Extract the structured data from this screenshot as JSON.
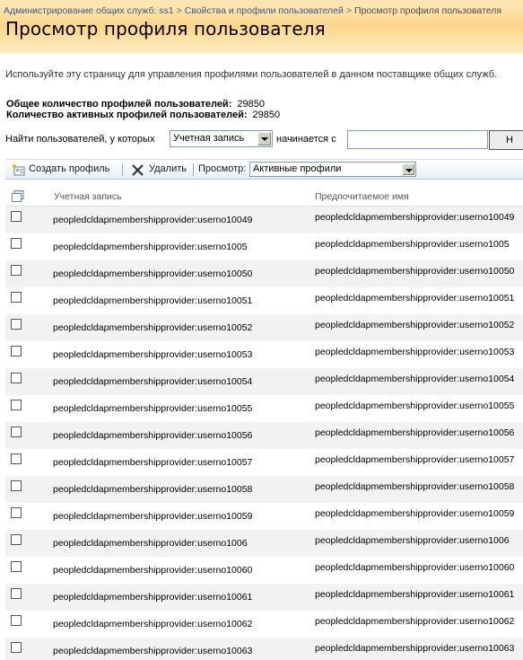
{
  "breadcrumb": {
    "items": [
      "Администрирование общих служб: ss1",
      "Свойства и профили пользователей",
      "Просмотр профиля пользователя"
    ],
    "separator": ">"
  },
  "page": {
    "title": "Просмотр профиля пользователя",
    "description": "Используйте эту страницу для управления профилями пользователей в данном поставщике общих служб."
  },
  "stats": {
    "total_label": "Общее количество профилей пользователей:",
    "total_value": "29850",
    "active_label": "Количество активных профилей пользователей:",
    "active_value": "29850"
  },
  "search": {
    "label": "Найти пользователей, у которых",
    "field_selected": "Учетная запись",
    "starts_with_label": "начинается с",
    "query": "",
    "button_label": "Н"
  },
  "toolbar": {
    "create_label": "Создать профиль",
    "delete_label": "Удалить",
    "view_label": "Просмотр:",
    "view_selected": "Активные профили"
  },
  "table": {
    "columns": [
      "Учетная запись",
      "Предпочитаемое имя"
    ],
    "rows": [
      {
        "account": "peopledcldapmembershipprovider:userno10049",
        "name": "peopledcldapmembershipprovider:userno10049"
      },
      {
        "account": "peopledcldapmembershipprovider:userno1005",
        "name": "peopledcldapmembershipprovider:userno1005"
      },
      {
        "account": "peopledcldapmembershipprovider:userno10050",
        "name": "peopledcldapmembershipprovider:userno10050"
      },
      {
        "account": "peopledcldapmembershipprovider:userno10051",
        "name": "peopledcldapmembershipprovider:userno10051"
      },
      {
        "account": "peopledcldapmembershipprovider:userno10052",
        "name": "peopledcldapmembershipprovider:userno10052"
      },
      {
        "account": "peopledcldapmembershipprovider:userno10053",
        "name": "peopledcldapmembershipprovider:userno10053"
      },
      {
        "account": "peopledcldapmembershipprovider:userno10054",
        "name": "peopledcldapmembershipprovider:userno10054"
      },
      {
        "account": "peopledcldapmembershipprovider:userno10055",
        "name": "peopledcldapmembershipprovider:userno10055"
      },
      {
        "account": "peopledcldapmembershipprovider:userno10056",
        "name": "peopledcldapmembershipprovider:userno10056"
      },
      {
        "account": "peopledcldapmembershipprovider:userno10057",
        "name": "peopledcldapmembershipprovider:userno10057"
      },
      {
        "account": "peopledcldapmembershipprovider:userno10058",
        "name": "peopledcldapmembershipprovider:userno10058"
      },
      {
        "account": "peopledcldapmembershipprovider:userno10059",
        "name": "peopledcldapmembershipprovider:userno10059"
      },
      {
        "account": "peopledcldapmembershipprovider:userno1006",
        "name": "peopledcldapmembershipprovider:userno1006"
      },
      {
        "account": "peopledcldapmembershipprovider:userno10060",
        "name": "peopledcldapmembershipprovider:userno10060"
      },
      {
        "account": "peopledcldapmembershipprovider:userno10061",
        "name": "peopledcldapmembershipprovider:userno10061"
      },
      {
        "account": "peopledcldapmembershipprovider:userno10062",
        "name": "peopledcldapmembershipprovider:userno10062"
      },
      {
        "account": "peopledcldapmembershipprovider:userno10063",
        "name": "peopledcldapmembershipprovider:userno10063"
      }
    ]
  },
  "colors": {
    "header_band": "#fdd58a",
    "breadcrumb_link": "#3b5a8a",
    "row_alt": "#f2f2f2",
    "toolbar_border": "#b8c8dc"
  },
  "icons": {
    "create": "new-profile-icon",
    "delete": "delete-x-icon",
    "select_all": "select-all-icon"
  }
}
